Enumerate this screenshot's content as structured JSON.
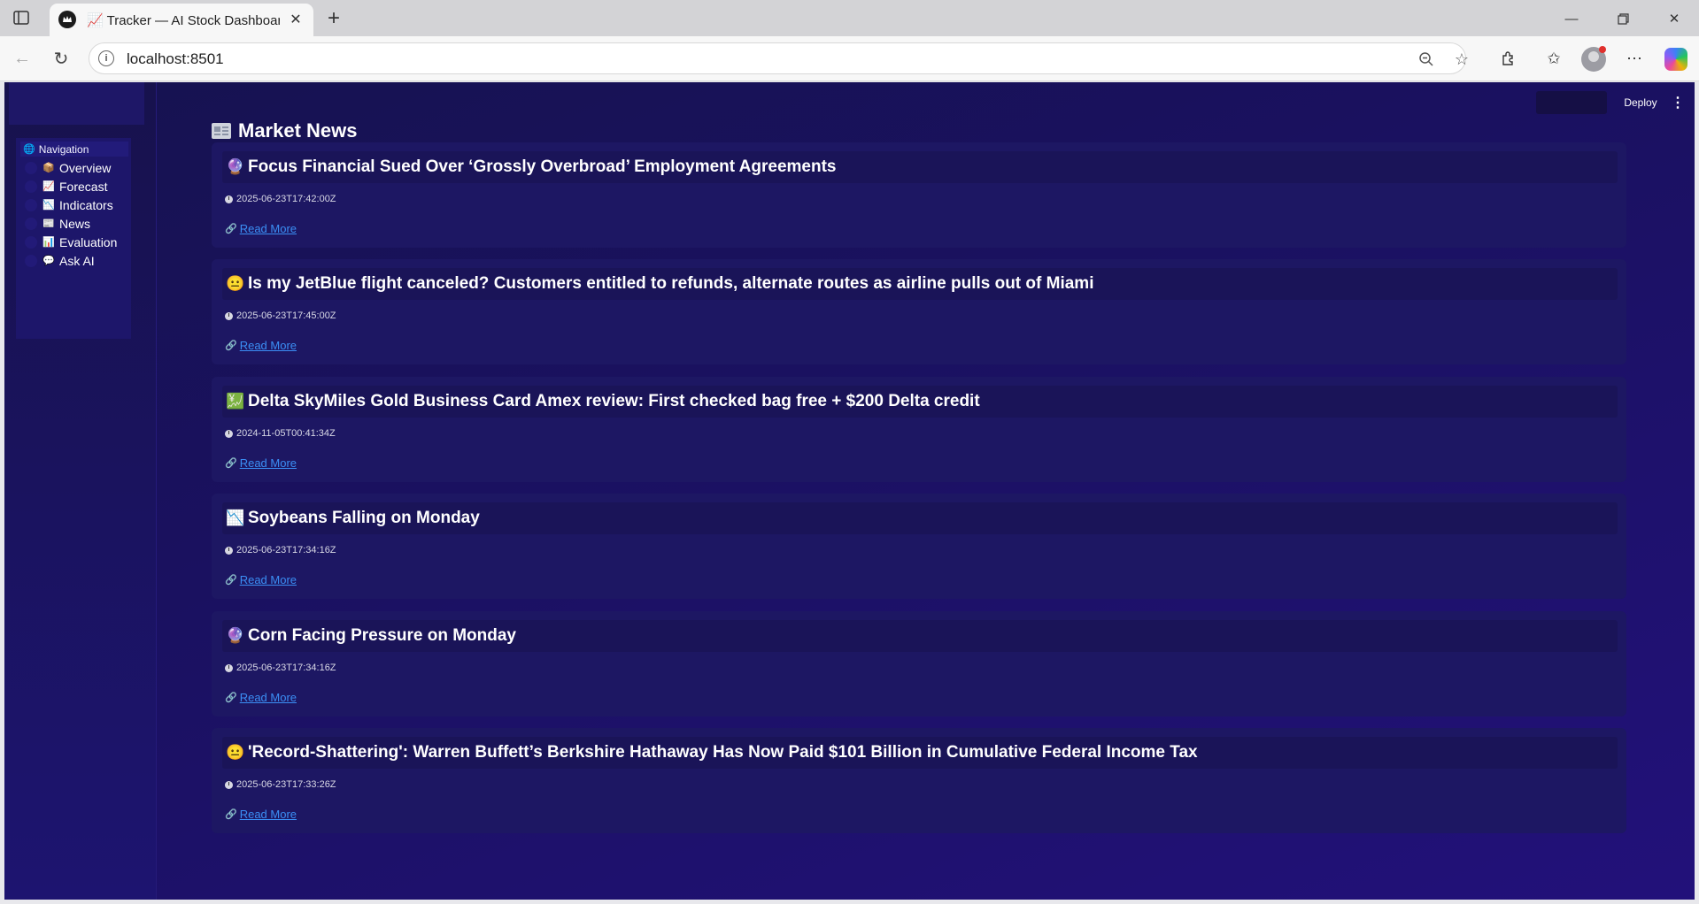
{
  "browser": {
    "tab_title": "Tracker — AI Stock Dashboard",
    "tab_emoji": "📈",
    "url": "localhost:8501"
  },
  "header": {
    "deploy_label": "Deploy"
  },
  "sidebar": {
    "nav_title": "Navigation",
    "nav_title_emoji": "🌐",
    "items": [
      {
        "emoji": "📦",
        "label": "Overview"
      },
      {
        "emoji": "📈",
        "label": "Forecast"
      },
      {
        "emoji": "📉",
        "label": "Indicators"
      },
      {
        "emoji": "📰",
        "label": "News"
      },
      {
        "emoji": "📊",
        "label": "Evaluation"
      },
      {
        "emoji": "💬",
        "label": "Ask AI"
      }
    ]
  },
  "main": {
    "title": "Market News",
    "articles": [
      {
        "emoji": "🔮",
        "title": "Focus Financial Sued Over ‘Grossly Overbroad’ Employment Agreements",
        "time": "2025-06-23T17:42:00Z",
        "link_label": "Read More"
      },
      {
        "emoji": "😐",
        "title": "Is my JetBlue flight canceled? Customers entitled to refunds, alternate routes as airline pulls out of Miami",
        "time": "2025-06-23T17:45:00Z",
        "link_label": "Read More"
      },
      {
        "emoji": "💹",
        "title": "Delta SkyMiles Gold Business Card Amex review: First checked bag free + $200 Delta credit",
        "time": "2024-11-05T00:41:34Z",
        "link_label": "Read More"
      },
      {
        "emoji": "📉",
        "title": "Soybeans Falling on Monday",
        "time": "2025-06-23T17:34:16Z",
        "link_label": "Read More"
      },
      {
        "emoji": "🔮",
        "title": "Corn Facing Pressure on Monday",
        "time": "2025-06-23T17:34:16Z",
        "link_label": "Read More"
      },
      {
        "emoji": "😐",
        "title": "'Record-Shattering': Warren Buffett’s Berkshire Hathaway Has Now Paid $101 Billion in Cumulative Federal Income Tax",
        "time": "2025-06-23T17:33:26Z",
        "link_label": "Read More"
      }
    ]
  }
}
